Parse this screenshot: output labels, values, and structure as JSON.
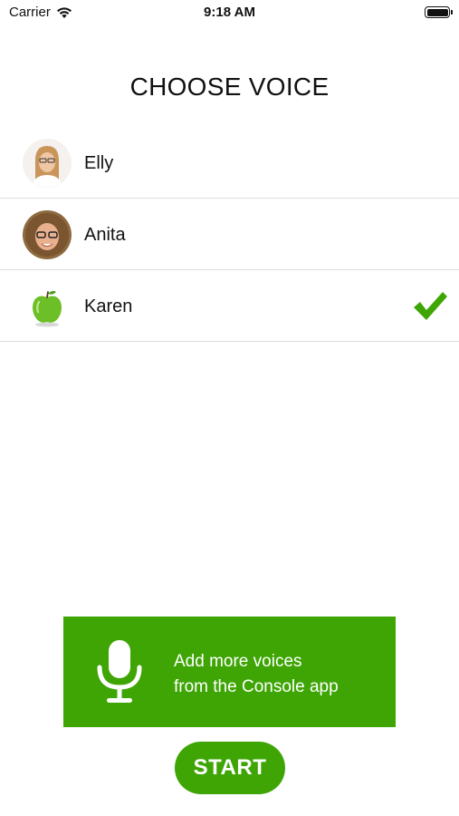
{
  "status_bar": {
    "carrier": "Carrier",
    "time": "9:18 AM",
    "wifi_icon": "wifi-icon",
    "battery_icon": "battery-icon"
  },
  "title": "CHOOSE VOICE",
  "voices": [
    {
      "name": "Elly",
      "avatar": "avatar-photo-woman-long-hair",
      "selected": false
    },
    {
      "name": "Anita",
      "avatar": "avatar-photo-woman-curly-hair",
      "selected": false
    },
    {
      "name": "Karen",
      "avatar": "green-apple-icon",
      "selected": true
    }
  ],
  "selected_icon": "checkmark-icon",
  "banner": {
    "icon": "microphone-icon",
    "line1": "Add more voices",
    "line2": "from the Console app"
  },
  "start_label": "START",
  "colors": {
    "accent_green": "#3ea505",
    "divider": "#dddddd",
    "text": "#111111"
  }
}
